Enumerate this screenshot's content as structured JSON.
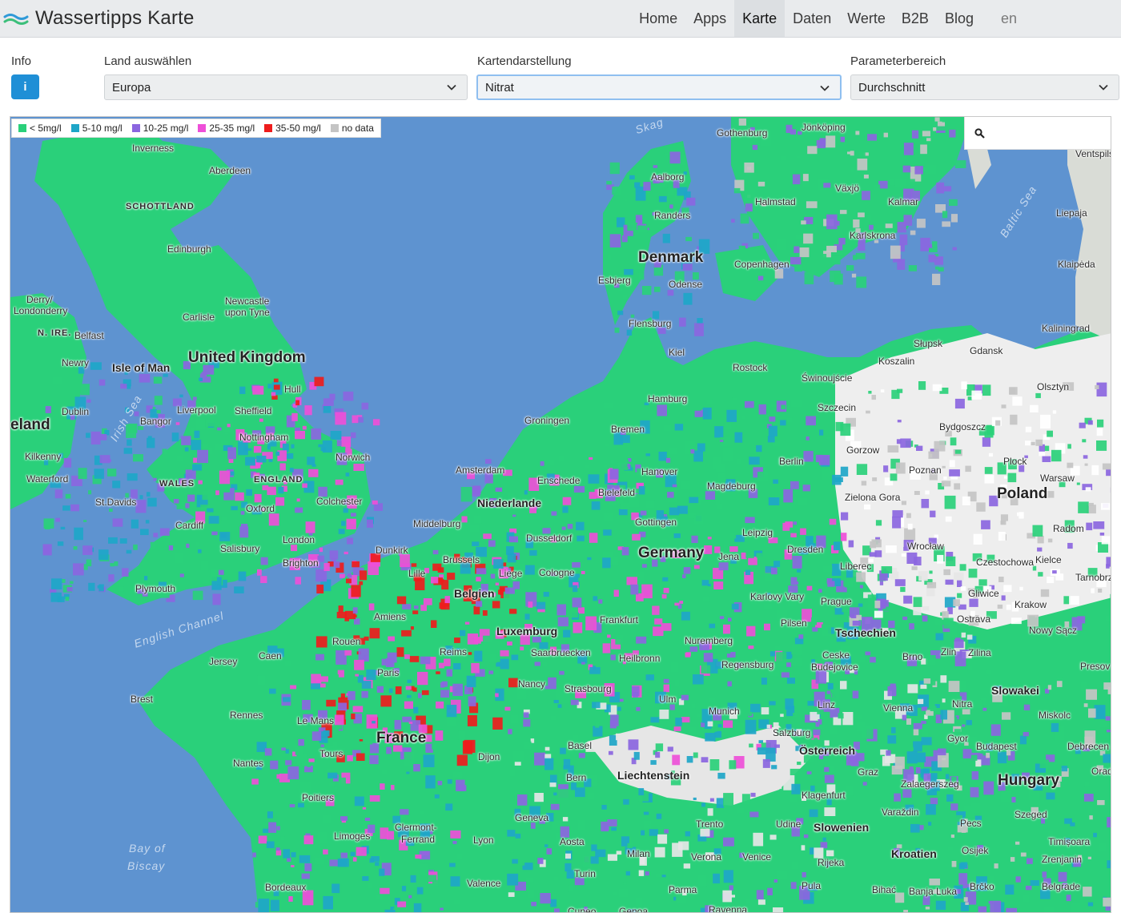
{
  "header": {
    "title": "Wassertipps Karte",
    "nav": [
      "Home",
      "Apps",
      "Karte",
      "Daten",
      "Werte",
      "B2B",
      "Blog"
    ],
    "active": "Karte",
    "lang": "en"
  },
  "controls": {
    "info_label": "Info",
    "info_button": "i",
    "land_label": "Land auswählen",
    "land_value": "Europa",
    "karte_label": "Kartendarstellung",
    "karte_value": "Nitrat",
    "param_label": "Parameterbereich",
    "param_value": "Durchschnitt"
  },
  "legend": [
    {
      "label": "< 5mg/l",
      "color": "#2ad07a"
    },
    {
      "label": "5-10 mg/l",
      "color": "#1ea6c8"
    },
    {
      "label": "10-25 mg/l",
      "color": "#8b66e0"
    },
    {
      "label": "25-35 mg/l",
      "color": "#ee4fd8"
    },
    {
      "label": "35-50 mg/l",
      "color": "#ee1c1c"
    },
    {
      "label": "no data",
      "color": "#c4c4c4"
    }
  ],
  "search": {
    "icon": "search-icon",
    "placeholder": ""
  },
  "map_labels": {
    "countries": [
      "United Kingdom",
      "Denmark",
      "Germany",
      "France",
      "Poland",
      "Niederlande",
      "Belgien",
      "Luxemburg",
      "Tschechien",
      "Österreich",
      "Slowakei",
      "Hungary",
      "Liechtenstein",
      "Slowenien",
      "Kroatien",
      "Isle of Man",
      "eland"
    ],
    "regions": [
      "SCHOTTLAND",
      "WALES",
      "ENGLAND",
      "N. IRE."
    ],
    "seas": [
      "English Channel",
      "Irish Sea",
      "Baltic Sea",
      "Bay of",
      "Biscay",
      "Skag"
    ],
    "cities": [
      "Inverness",
      "Aberdeen",
      "Edinburgh",
      "Carlisle",
      "Newcastle",
      "upon Tyne",
      "Derry/",
      "Londonderry",
      "Belfast",
      "Newry",
      "Dublin",
      "Bangor",
      "Liverpool",
      "Sheffield",
      "Hull",
      "Nottingham",
      "Kilkenny",
      "Waterford",
      "St.Davids",
      "Cardiff",
      "Oxford",
      "Norwich",
      "Colchester",
      "London",
      "Salisbury",
      "Brighton",
      "Plymouth",
      "Jersey",
      "Gothenburg",
      "Jönköping",
      "Aalborg",
      "Halmstad",
      "Växjö",
      "Kalmar",
      "Randers",
      "Karlskrona",
      "Copenhagen",
      "Esbjerg",
      "Odense",
      "Flensburg",
      "Kiel",
      "Rostock",
      "Świnoujście",
      "Hamburg",
      "Szczecin",
      "Groningen",
      "Bremen",
      "Amsterdam",
      "Hanover",
      "Enschede",
      "Bielefeld",
      "Magdeburg",
      "Berlin",
      "Gorzow",
      "Zielona Gora",
      "Poznan",
      "Bydgoszcz",
      "Plock",
      "Warsaw",
      "Dunkirk",
      "Lille",
      "Brussels",
      "Liege",
      "Cologne",
      "Dusseldorf",
      "Middelburg",
      "Gottingen",
      "Leipzig",
      "Jena",
      "Dresden",
      "Wrocław",
      "Liberec",
      "Karlovy Vary",
      "Prague",
      "Pilsen",
      "Czestochowa",
      "Kielce",
      "Radom",
      "Gliwice",
      "Krakow",
      "Ostrava",
      "Tarnobrzeg",
      "Nowy Sącz",
      "Amiens",
      "Rouen",
      "Caen",
      "Paris",
      "Reims",
      "Frankfurt",
      "Nuremberg",
      "Saarbruecken",
      "Heilbronn",
      "Regensburg",
      "Ceske",
      "Budejovice",
      "Brno",
      "Zlin",
      "Zilina",
      "Presov",
      "Brest",
      "Rennes",
      "Le Mans",
      "Nancy",
      "Strasbourg",
      "Ulm",
      "Munich",
      "Linz",
      "Vienna",
      "Nitra",
      "Miskolc",
      "Tours",
      "Nantes",
      "Dijon",
      "Basel",
      "Bern",
      "Salzburg",
      "Gyor",
      "Budapest",
      "Debrecen",
      "Poitiers",
      "Geneva",
      "Trento",
      "Udine",
      "Klagenfurt",
      "Graz",
      "Zalaegerszeg",
      "Varaždin",
      "Pecs",
      "Szeged",
      "Orad",
      "Limoges",
      "Clermont-",
      "Ferrand",
      "Lyon",
      "Aosta",
      "Milan",
      "Verona",
      "Venice",
      "Rijeka",
      "Osijek",
      "Timișoara",
      "Zrenjanin",
      "Bordeaux",
      "Valence",
      "Turin",
      "Parma",
      "Pula",
      "Bihać",
      "Banja Luka",
      "Brčko",
      "Belgrade",
      "Liepaja",
      "Klaipėda",
      "Kaliningrad",
      "Słupsk",
      "Gdansk",
      "Koszalin",
      "Olsztyn",
      "Ventspils",
      "Cuneo",
      "Genoa",
      "Ravenna"
    ]
  }
}
